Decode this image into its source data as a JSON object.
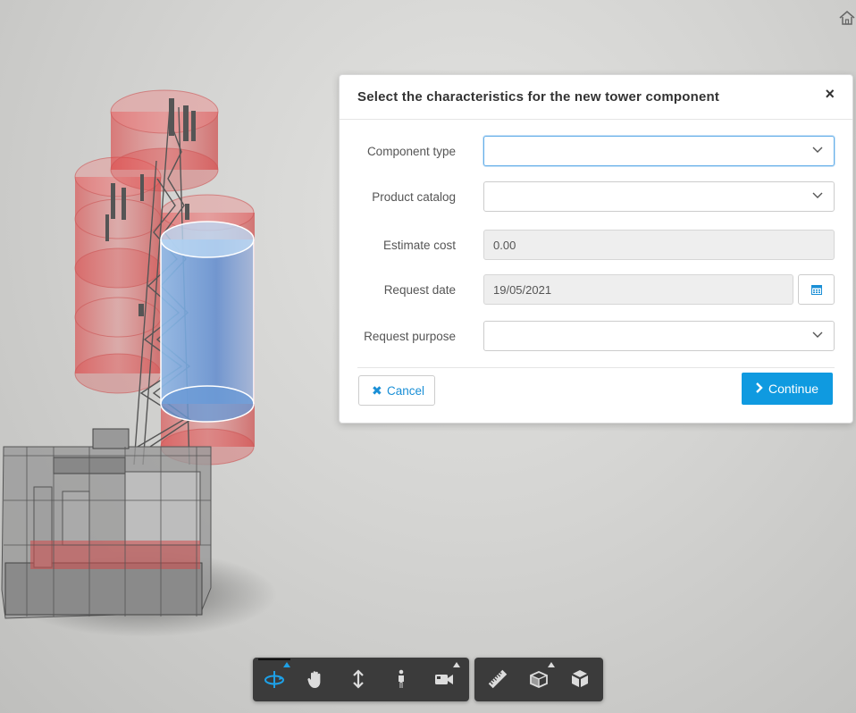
{
  "dialog": {
    "title": "Select the characteristics for the new tower component",
    "close_label": "×",
    "fields": {
      "component_type": {
        "label": "Component type",
        "value": ""
      },
      "product_catalog": {
        "label": "Product catalog",
        "value": ""
      },
      "estimate_cost": {
        "label": "Estimate cost",
        "value": "0.00"
      },
      "request_date": {
        "label": "Request date",
        "value": "19/05/2021"
      },
      "request_purpose": {
        "label": "Request purpose",
        "value": ""
      }
    },
    "cancel_label": "Cancel",
    "continue_label": "Continue"
  },
  "toolbar": {
    "navigation": [
      "orbit-icon",
      "pan-icon",
      "zoom-icon",
      "walk-icon",
      "camera-icon"
    ],
    "tools": [
      "measure-icon",
      "section-icon",
      "model-icon"
    ]
  },
  "colors": {
    "accent": "#0f9ae0",
    "link": "#1a8fd6",
    "toolbar_bg": "#3b3b3b",
    "active_tool": "#1ea0e6",
    "tower_highlight_red": "#d63a3a",
    "tower_highlight_blue": "#7fb3e6"
  }
}
